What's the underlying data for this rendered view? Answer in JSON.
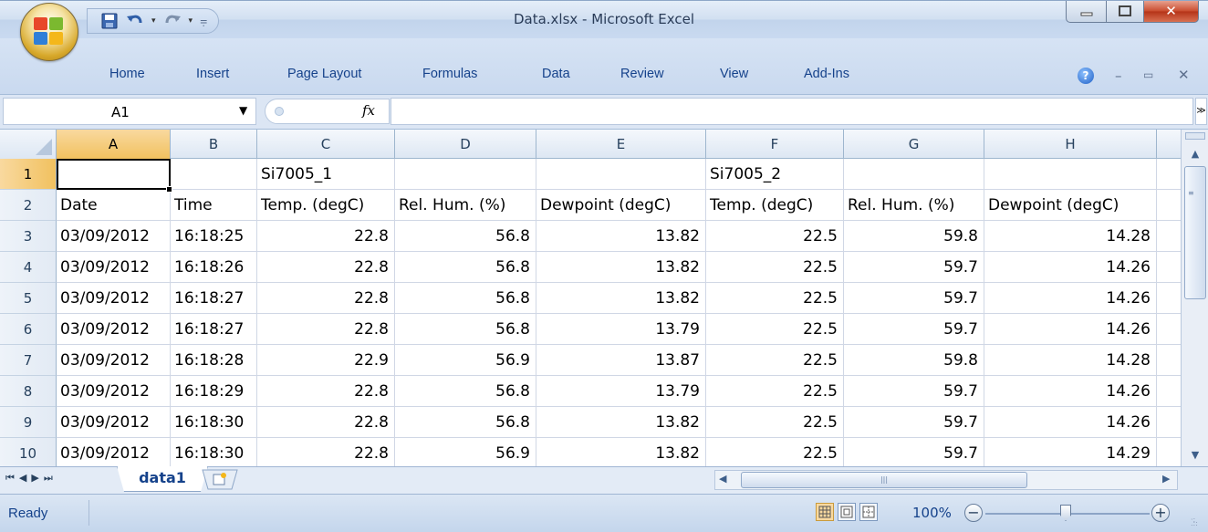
{
  "window": {
    "title": "Data.xlsx - Microsoft Excel"
  },
  "ribbon": {
    "tabs": [
      "Home",
      "Insert",
      "Page Layout",
      "Formulas",
      "Data",
      "Review",
      "View",
      "Add-Ins"
    ]
  },
  "formula_bar": {
    "name_box": "A1",
    "fx_label": "fx",
    "content": ""
  },
  "sheet": {
    "columns": [
      "A",
      "B",
      "C",
      "D",
      "E",
      "F",
      "G",
      "H"
    ],
    "active_cell": "A1",
    "rows": [
      {
        "num": "1",
        "cells": [
          "",
          "",
          "Si7005_1",
          "",
          "",
          "Si7005_2",
          "",
          ""
        ]
      },
      {
        "num": "2",
        "cells": [
          "Date",
          "Time",
          "Temp. (degC)",
          "Rel. Hum. (%)",
          "Dewpoint (degC)",
          "Temp. (degC)",
          "Rel. Hum. (%)",
          "Dewpoint (degC)"
        ]
      },
      {
        "num": "3",
        "cells": [
          "03/09/2012",
          "16:18:25",
          "22.8",
          "56.8",
          "13.82",
          "22.5",
          "59.8",
          "14.28"
        ]
      },
      {
        "num": "4",
        "cells": [
          "03/09/2012",
          "16:18:26",
          "22.8",
          "56.8",
          "13.82",
          "22.5",
          "59.7",
          "14.26"
        ]
      },
      {
        "num": "5",
        "cells": [
          "03/09/2012",
          "16:18:27",
          "22.8",
          "56.8",
          "13.82",
          "22.5",
          "59.7",
          "14.26"
        ]
      },
      {
        "num": "6",
        "cells": [
          "03/09/2012",
          "16:18:27",
          "22.8",
          "56.8",
          "13.79",
          "22.5",
          "59.7",
          "14.26"
        ]
      },
      {
        "num": "7",
        "cells": [
          "03/09/2012",
          "16:18:28",
          "22.9",
          "56.9",
          "13.87",
          "22.5",
          "59.8",
          "14.28"
        ]
      },
      {
        "num": "8",
        "cells": [
          "03/09/2012",
          "16:18:29",
          "22.8",
          "56.8",
          "13.79",
          "22.5",
          "59.7",
          "14.26"
        ]
      },
      {
        "num": "9",
        "cells": [
          "03/09/2012",
          "16:18:30",
          "22.8",
          "56.8",
          "13.82",
          "22.5",
          "59.7",
          "14.26"
        ]
      },
      {
        "num": "10",
        "cells": [
          "03/09/2012",
          "16:18:30",
          "22.8",
          "56.9",
          "13.82",
          "22.5",
          "59.7",
          "14.29"
        ]
      }
    ],
    "tab_name": "data1"
  },
  "status_bar": {
    "ready": "Ready",
    "zoom": "100%"
  },
  "colors": {
    "ribbon_text": "#15428b",
    "active_header": "#f1c15f",
    "close_button": "#c94a2c"
  },
  "icons": {
    "office_button": "office-logo",
    "quick_access": [
      "save-icon",
      "undo-icon",
      "redo-icon",
      "customize-icon"
    ],
    "window_controls": [
      "minimize-icon",
      "maximize-icon",
      "close-icon"
    ],
    "ribbon_right": [
      "help-icon",
      "minimize-ribbon-icon",
      "restore-icon",
      "close-workbook-icon"
    ]
  }
}
